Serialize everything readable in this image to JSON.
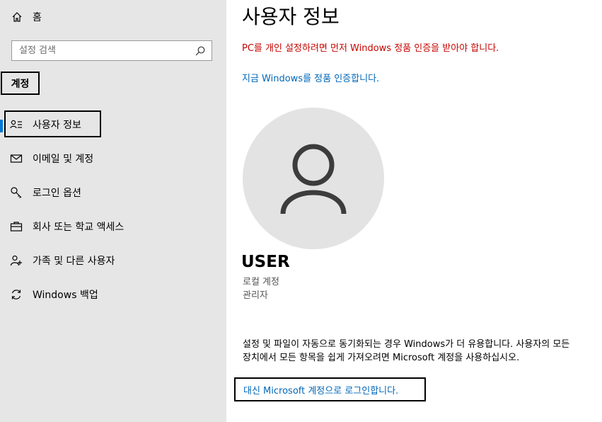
{
  "sidebar": {
    "home": {
      "label": "홈",
      "icon": "home-icon"
    },
    "search": {
      "placeholder": "설정 검색",
      "icon": "search-icon"
    },
    "section_heading": "계정",
    "items": [
      {
        "label": "사용자 정보",
        "icon": "user-info-icon",
        "selected": true
      },
      {
        "label": "이메일 및 계정",
        "icon": "mail-icon",
        "selected": false
      },
      {
        "label": "로그인 옵션",
        "icon": "key-icon",
        "selected": false
      },
      {
        "label": "회사 또는 학교 액세스",
        "icon": "briefcase-icon",
        "selected": false
      },
      {
        "label": "가족 및 다른 사용자",
        "icon": "add-person-icon",
        "selected": false
      },
      {
        "label": "Windows 백업",
        "icon": "sync-icon",
        "selected": false
      }
    ],
    "accent_color": "#0078d7"
  },
  "main": {
    "title": "사용자 정보",
    "activation_warning": "PC를 개인 설정하려면 먼저 Windows 정품 인증을 받아야 합니다.",
    "activate_link": "지금 Windows를 정품 인증합니다.",
    "avatar_icon": "person-icon",
    "user_name": "USER",
    "account_type": "로컬 계정",
    "account_role": "관리자",
    "sync_description": "설정 및 파일이 자동으로 동기화되는 경우 Windows가 더 유용합니다. 사용자의 모든 장치에서 모든 항목을 쉽게 가져오려면 Microsoft 계정을 사용하십시오.",
    "ms_signin_link": "대신 Microsoft 계정으로 로그인합니다.",
    "warning_color": "#c50500",
    "link_color": "#0067b8"
  }
}
